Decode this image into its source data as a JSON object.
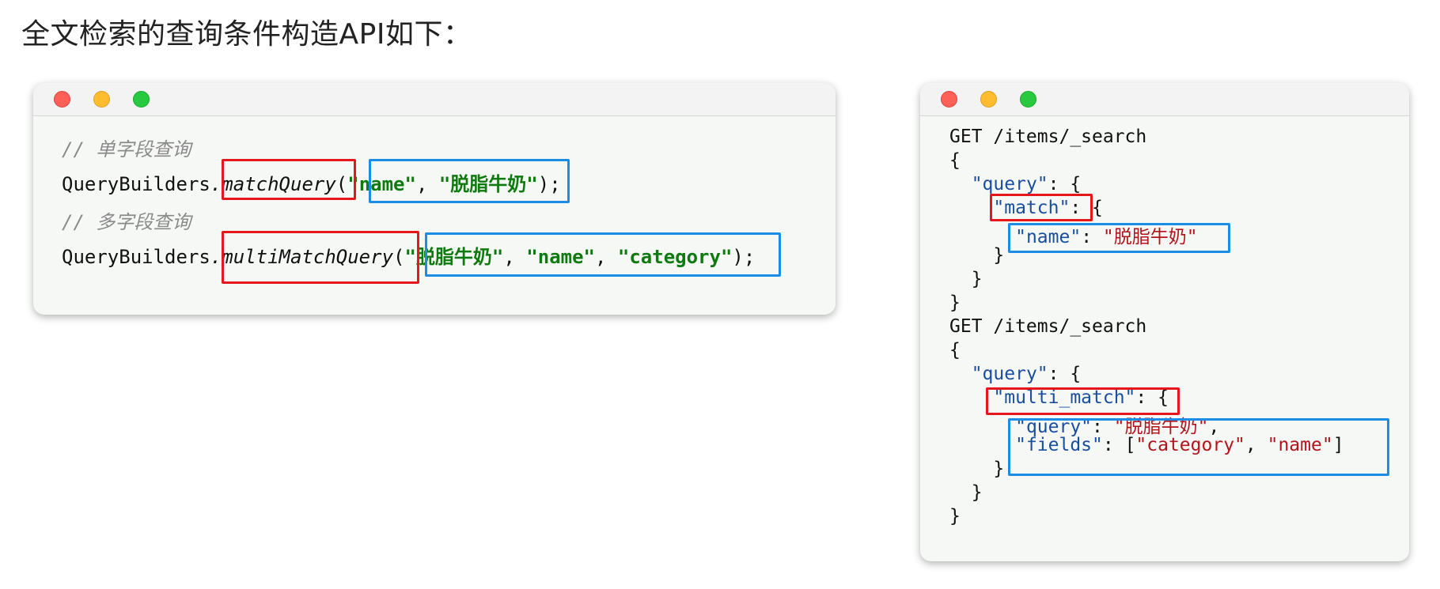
{
  "heading": "全文检索的查询条件构造API如下：",
  "java": {
    "comment1": "// 单字段查询",
    "line1": {
      "prefix": "QueryBuilders",
      "method": ".matchQuery",
      "open": "(",
      "arg1": "\"name\"",
      "sep": ", ",
      "arg2": "\"脱脂牛奶\"",
      "close": ");"
    },
    "comment2": "// 多字段查询",
    "line2": {
      "prefix": "QueryBuilders",
      "method": ".multiMatchQuery",
      "open": "(",
      "arg1": "\"脱脂牛奶\"",
      "sep1": ", ",
      "arg2": "\"name\"",
      "sep2": ", ",
      "arg3": "\"category\"",
      "close": ");"
    }
  },
  "dsl": {
    "get1": "GET /items/_search",
    "open_brace": "{",
    "query_key": "\"query\"",
    "colon_brace": ": {",
    "match_key": "\"match\"",
    "match_after": ": {",
    "name_key": "\"name\"",
    "colon": ": ",
    "name_value": "\"脱脂牛奶\"",
    "close_brace": "}",
    "get2": "GET /items/_search",
    "multi_key": "\"multi_match\"",
    "multi_after": ": {",
    "query_value": "\"脱脂牛奶\"",
    "comma": ",",
    "fields_key": "\"fields\"",
    "fields_open": ": [",
    "field1": "\"category\"",
    "field_sep": ", ",
    "field2": "\"name\"",
    "fields_close": "]"
  },
  "colors": {
    "highlight_red": "#e5161c",
    "highlight_blue": "#1c8de6",
    "string_green": "#0f7a0f",
    "json_key": "#1a4fa0",
    "json_string": "#b3141b"
  }
}
